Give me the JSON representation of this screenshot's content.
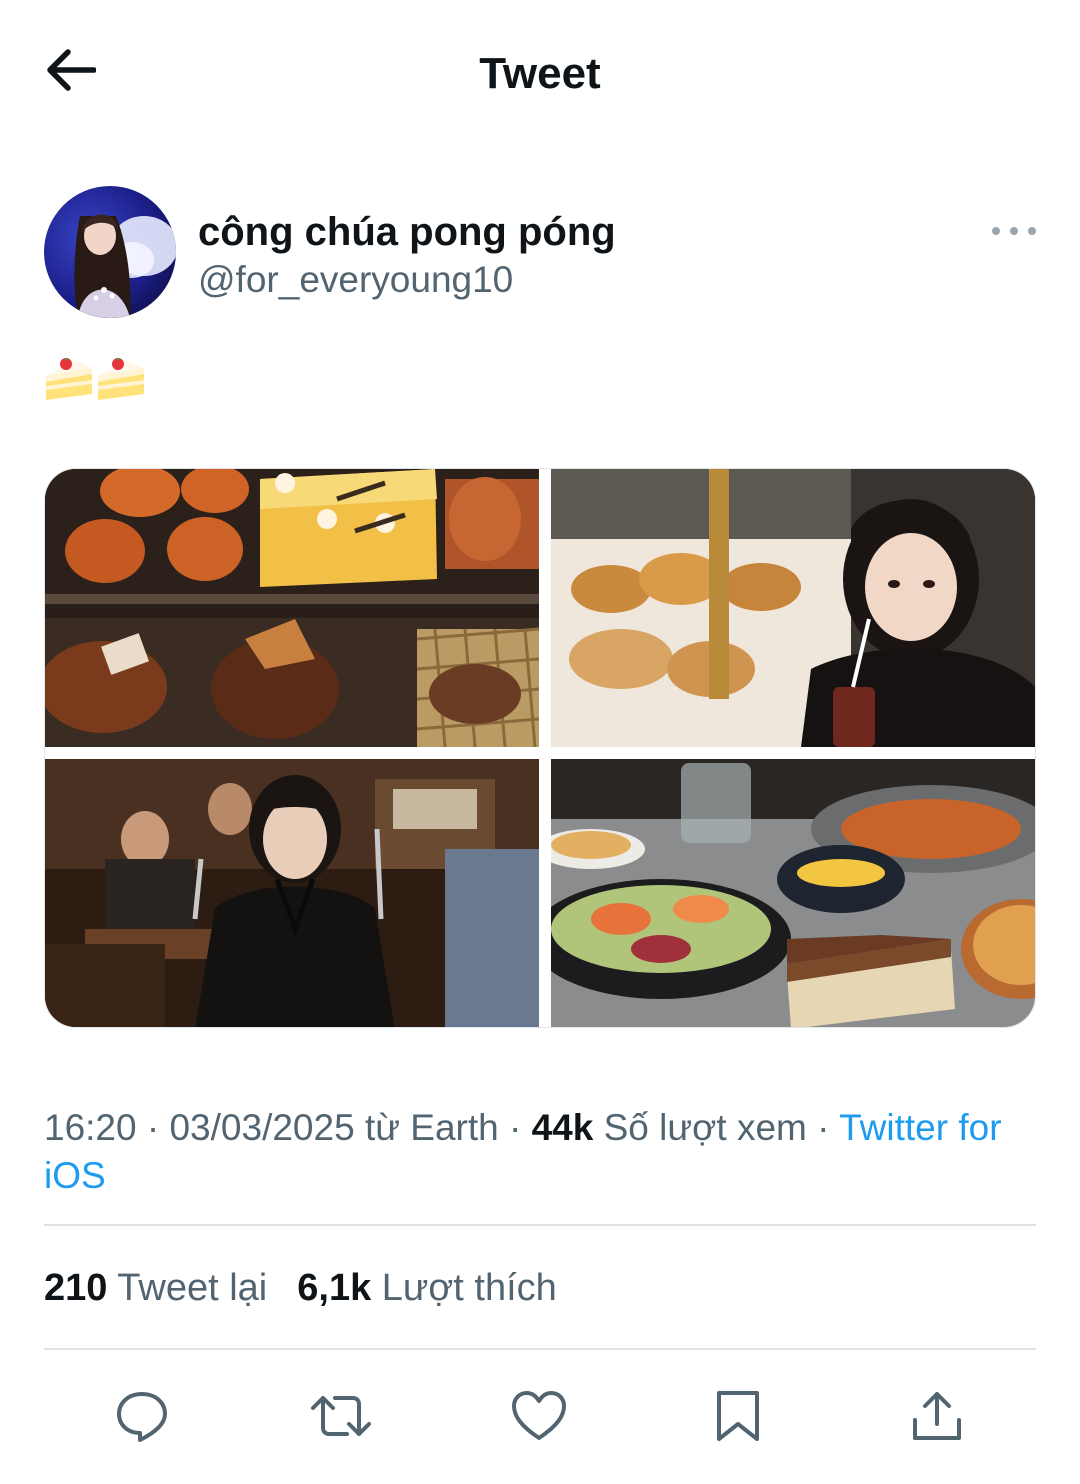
{
  "header": {
    "title": "Tweet",
    "back_icon": "arrow-left-icon"
  },
  "author": {
    "display_name": "công chúa pong póng",
    "handle": "@for_everyoung10"
  },
  "tweet": {
    "text_emoji": [
      "shortcake-emoji",
      "shortcake-emoji"
    ],
    "media_count": 4
  },
  "meta": {
    "time": "16:20",
    "sep1": " · ",
    "date": "03/03/2025",
    "location": " từ Earth",
    "sep2": " · ",
    "views_count": "44k",
    "views_label": " Số lượt xem",
    "sep3": " · ",
    "source": "Twitter for iOS"
  },
  "stats": {
    "retweets_count": "210",
    "retweets_label": "Tweet lại",
    "likes_count": "6,1k",
    "likes_label": "Lượt thích"
  },
  "actions": [
    "reply-icon",
    "retweet-icon",
    "like-icon",
    "bookmark-icon",
    "share-icon"
  ],
  "colors": {
    "link": "#1d9bf0",
    "secondary_text": "#536471",
    "primary_text": "#0f1419",
    "divider": "#dfe4e8"
  }
}
